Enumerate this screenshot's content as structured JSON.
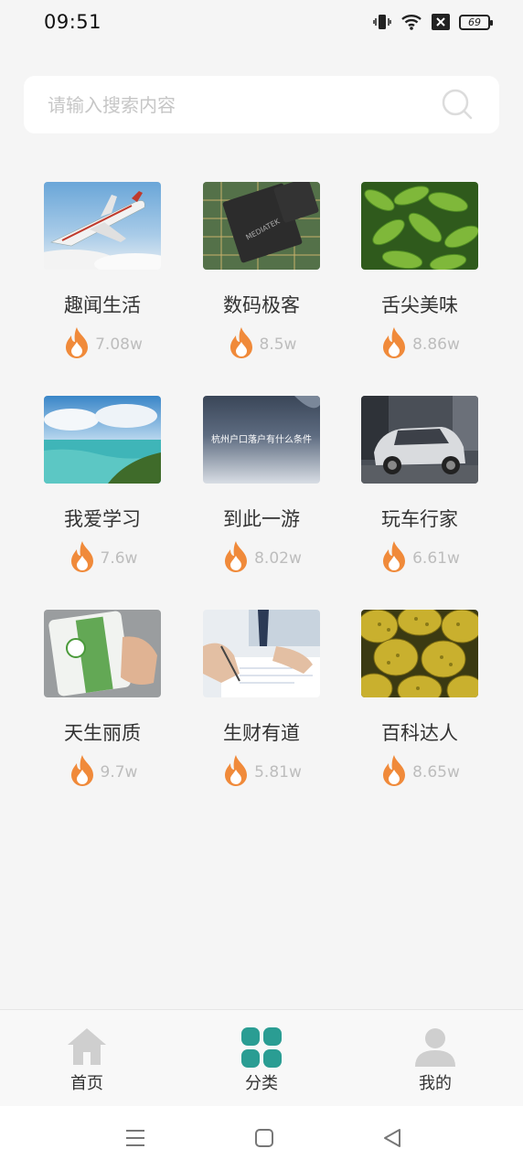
{
  "status_bar": {
    "time": "09:51",
    "battery": "69"
  },
  "search": {
    "placeholder": "请输入搜索内容"
  },
  "categories": [
    {
      "title": "趣闻生活",
      "count": "7.08w",
      "image": "airplane"
    },
    {
      "title": "数码极客",
      "count": "8.5w",
      "image": "chip"
    },
    {
      "title": "舌尖美味",
      "count": "8.86w",
      "image": "edamame"
    },
    {
      "title": "我爱学习",
      "count": "7.6w",
      "image": "beach"
    },
    {
      "title": "到此一游",
      "count": "8.02w",
      "image": "slide",
      "image_text": "杭州户口落户有什么条件"
    },
    {
      "title": "玩车行家",
      "count": "6.61w",
      "image": "car"
    },
    {
      "title": "天生丽质",
      "count": "9.7w",
      "image": "product"
    },
    {
      "title": "生财有道",
      "count": "5.81w",
      "image": "writing"
    },
    {
      "title": "百科达人",
      "count": "8.65w",
      "image": "durian"
    }
  ],
  "tabbar": [
    {
      "label": "首页",
      "icon": "home-icon",
      "active": false
    },
    {
      "label": "分类",
      "icon": "grid-icon",
      "active": true
    },
    {
      "label": "我的",
      "icon": "user-icon",
      "active": false
    }
  ],
  "colors": {
    "accent": "#2a9d93",
    "inactive_icon": "#cfcfcf",
    "flame": "#f08a3a"
  }
}
